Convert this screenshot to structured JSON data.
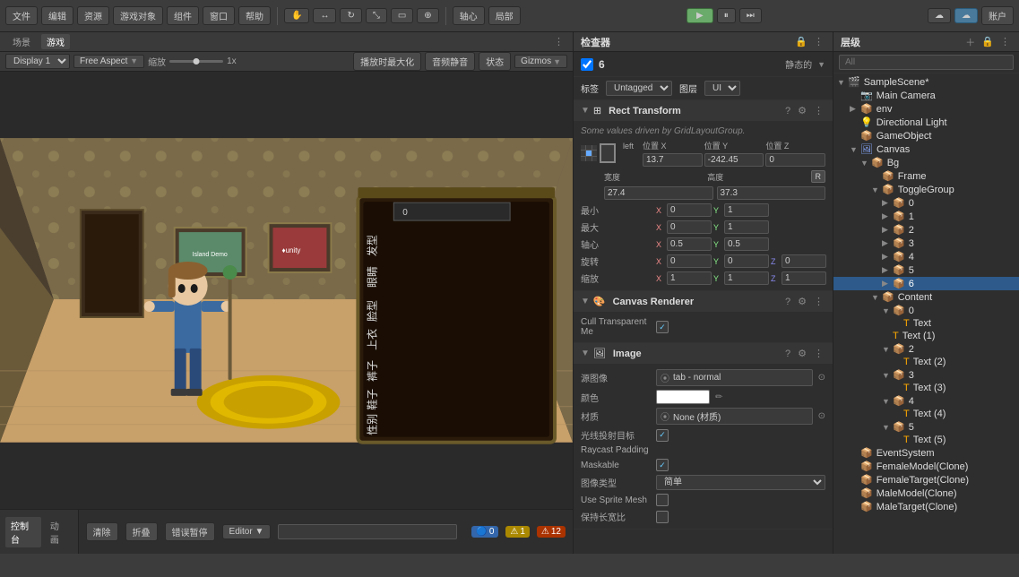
{
  "topToolbar": {
    "menus": [
      "文件",
      "编辑",
      "资源",
      "游戏对象",
      "组件",
      "窗口",
      "帮助"
    ],
    "tools": [
      "手型",
      "移动",
      "旋转",
      "缩放",
      "矩形",
      "变换"
    ],
    "pivot": "轴心",
    "global": "局部",
    "playBtn": "▶",
    "pauseBtn": "⏸",
    "stepBtn": "⏭",
    "cloudBtn": "☁",
    "accountBtn": "账户"
  },
  "gameToolbar": {
    "displayLabel": "Display 1",
    "aspectLabel": "Free Aspect",
    "zoomLabel": "缩放",
    "zoomValue": "1x",
    "maxBtn": "播放时最大化",
    "audioBtn": "音频静音",
    "stateBtn": "状态",
    "gizmosBtn": "Gizmos"
  },
  "inspector": {
    "title": "检查器",
    "objectId": "6",
    "staticLabel": "静态的",
    "tagLabel": "标签",
    "tagValue": "Untagged",
    "layerLabel": "图层",
    "layerValue": "UI",
    "components": [
      {
        "name": "Rect Transform",
        "fields": {
          "hint": "Some values driven by GridLayoutGroup.",
          "posLabel": "left",
          "posX": "位置 X",
          "posY": "位置 Y",
          "posZ": "位置 Z",
          "posXVal": "13.7",
          "posYVal": "-242.45",
          "posZVal": "0",
          "widthLabel": "宽度",
          "heightLabel": "高度",
          "widthVal": "27.4",
          "heightVal": "37.3",
          "anchorMin": "最小",
          "anchorMax": "最大",
          "anchorMinX": "0",
          "anchorMinY": "1",
          "anchorMaxX": "0",
          "anchorMaxY": "1",
          "pivotLabel": "轴心",
          "pivotX": "0.5",
          "pivotY": "0.5",
          "rotLabel": "旋转",
          "rotX": "0",
          "rotY": "0",
          "rotZ": "0",
          "scaleLabel": "缩放",
          "scaleX": "1",
          "scaleY": "1",
          "scaleZ": "1",
          "rBtn": "R"
        }
      },
      {
        "name": "Canvas Renderer",
        "fields": {
          "cullLabel": "Cull Transparent Me",
          "cullChecked": true
        }
      },
      {
        "name": "Image",
        "fields": {
          "spriteLabel": "源图像",
          "spriteValue": "tab - normal",
          "colorLabel": "颜色",
          "materialLabel": "材质",
          "materialValue": "None (材质)",
          "raycastLabel": "光线投射目标",
          "raycastChecked": true,
          "raycastPadding": "Raycast Padding",
          "maskable": "Maskable",
          "maskableChecked": true,
          "imageType": "图像类型",
          "imageTypeValue": "简单",
          "useSpriteLabel": "Use Sprite Mesh",
          "preserveLabel": "保持长宽比"
        }
      }
    ]
  },
  "hierarchy": {
    "title": "层级",
    "searchPlaceholder": "All",
    "tree": [
      {
        "label": "SampleScene*",
        "level": 0,
        "hasChildren": true,
        "icon": "scene"
      },
      {
        "label": "Main Camera",
        "level": 1,
        "hasChildren": false,
        "icon": "camera"
      },
      {
        "label": "env",
        "level": 1,
        "hasChildren": true,
        "icon": "gameobj"
      },
      {
        "label": "Directional Light",
        "level": 1,
        "hasChildren": false,
        "icon": "light"
      },
      {
        "label": "GameObject",
        "level": 1,
        "hasChildren": false,
        "icon": "gameobj"
      },
      {
        "label": "Canvas",
        "level": 1,
        "hasChildren": true,
        "icon": "canvas"
      },
      {
        "label": "Bg",
        "level": 2,
        "hasChildren": true,
        "icon": "gameobj"
      },
      {
        "label": "Frame",
        "level": 3,
        "hasChildren": false,
        "icon": "gameobj"
      },
      {
        "label": "ToggleGroup",
        "level": 3,
        "hasChildren": true,
        "icon": "gameobj"
      },
      {
        "label": "0",
        "level": 4,
        "hasChildren": true,
        "icon": "gameobj"
      },
      {
        "label": "1",
        "level": 4,
        "hasChildren": true,
        "icon": "gameobj"
      },
      {
        "label": "2",
        "level": 4,
        "hasChildren": true,
        "icon": "gameobj"
      },
      {
        "label": "3",
        "level": 4,
        "hasChildren": true,
        "icon": "gameobj"
      },
      {
        "label": "4",
        "level": 4,
        "hasChildren": true,
        "icon": "gameobj"
      },
      {
        "label": "5",
        "level": 4,
        "hasChildren": true,
        "icon": "gameobj"
      },
      {
        "label": "6",
        "level": 4,
        "hasChildren": true,
        "icon": "gameobj",
        "selected": true
      },
      {
        "label": "Content",
        "level": 3,
        "hasChildren": true,
        "icon": "gameobj"
      },
      {
        "label": "0",
        "level": 4,
        "hasChildren": true,
        "icon": "gameobj"
      },
      {
        "label": "Text",
        "level": 5,
        "hasChildren": false,
        "icon": "text"
      },
      {
        "label": "Text (1)",
        "level": 4,
        "hasChildren": false,
        "icon": "text"
      },
      {
        "label": "2",
        "level": 4,
        "hasChildren": true,
        "icon": "gameobj"
      },
      {
        "label": "Text (2)",
        "level": 5,
        "hasChildren": false,
        "icon": "text"
      },
      {
        "label": "3",
        "level": 4,
        "hasChildren": true,
        "icon": "gameobj"
      },
      {
        "label": "Text (3)",
        "level": 5,
        "hasChildren": false,
        "icon": "text"
      },
      {
        "label": "4",
        "level": 4,
        "hasChildren": true,
        "icon": "gameobj"
      },
      {
        "label": "Text (4)",
        "level": 5,
        "hasChildren": false,
        "icon": "text"
      },
      {
        "label": "5",
        "level": 4,
        "hasChildren": true,
        "icon": "gameobj"
      },
      {
        "label": "Text (5)",
        "level": 5,
        "hasChildren": false,
        "icon": "text"
      },
      {
        "label": "EventSystem",
        "level": 1,
        "hasChildren": false,
        "icon": "gameobj"
      },
      {
        "label": "FemaleModel(Clone)",
        "level": 1,
        "hasChildren": false,
        "icon": "gameobj"
      },
      {
        "label": "FemaleTarget(Clone)",
        "level": 1,
        "hasChildren": false,
        "icon": "gameobj"
      },
      {
        "label": "MaleModel(Clone)",
        "level": 1,
        "hasChildren": false,
        "icon": "gameobj"
      },
      {
        "label": "MaleTarget(Clone)",
        "level": 1,
        "hasChildren": false,
        "icon": "gameobj"
      }
    ]
  },
  "console": {
    "tabs": [
      "控制台",
      "动画"
    ],
    "buttons": [
      "清除",
      "折叠",
      "错误暂停",
      "Editor"
    ],
    "searchPlaceholder": "",
    "warnCount": "1",
    "errCount": "12",
    "infoCount": "0"
  }
}
